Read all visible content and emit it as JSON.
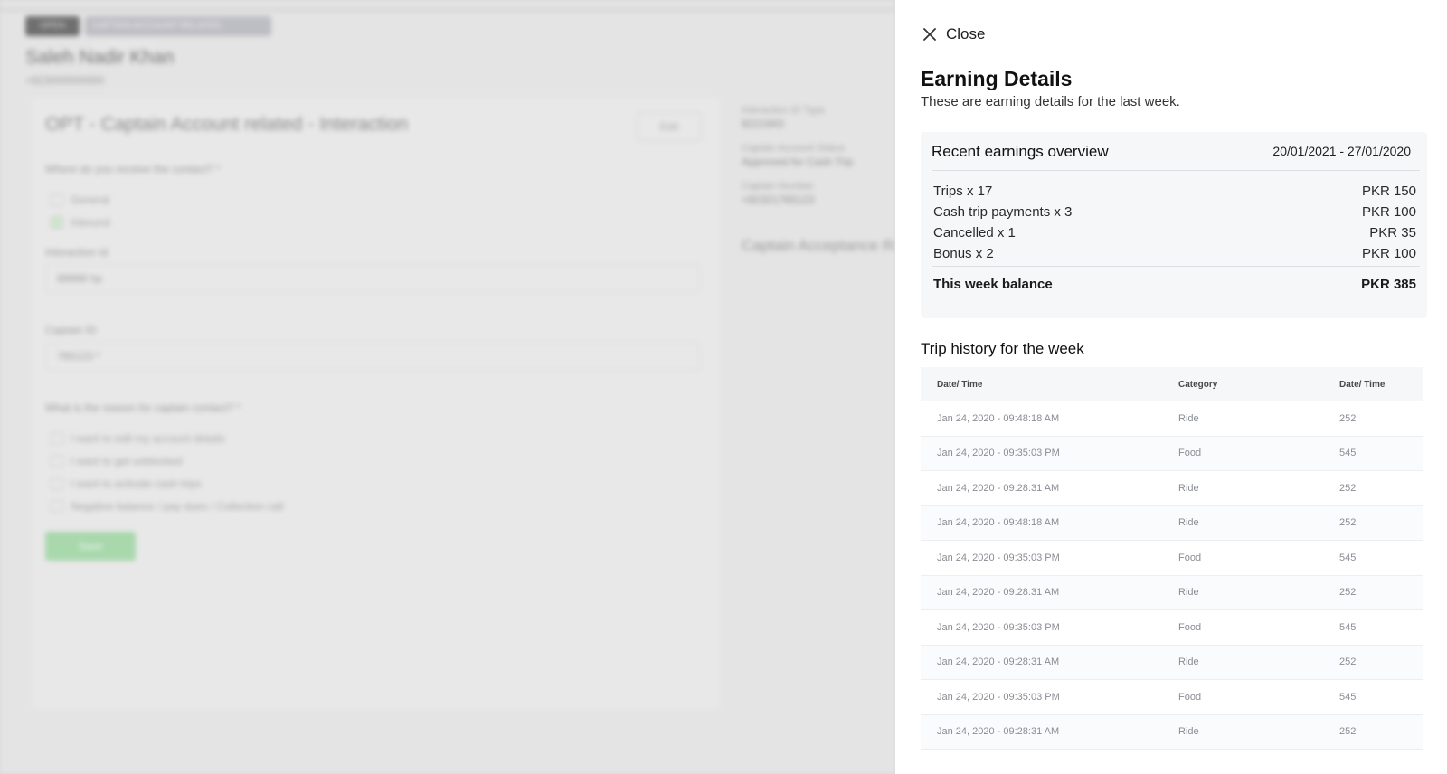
{
  "background": {
    "badge_dark": "OPEN",
    "badge_light": "CAPTAIN ACCOUNT RELATED · INTERACTION",
    "person_name": "Saleh Nadir Khan",
    "person_sub": "+923000000000",
    "card_title": "OPT - Captain Account related - Interaction",
    "card_button": "Edit",
    "question1": "Where do you receive the contact? *",
    "option_general": "General",
    "option_inbound": "Inbound",
    "interaction_label": "Interaction Id",
    "interaction_value": "88888 hp",
    "captain_label": "Captain ID",
    "captain_value": "765123 *",
    "question2": "What is the reason for captain contact? *",
    "reasons": [
      "I want to edit my account details",
      "I want to get unblocked",
      "I want to activate cash trips",
      "Negative balance / pay dues / Collection call"
    ],
    "save_button": "Save",
    "right_label1": "Interaction ID Type",
    "right_value1": "8221943",
    "right_label2": "Captain Account Status",
    "right_value2": "Approved for Cash Trip",
    "right_label3": "Captain Number",
    "right_value3": "+92321765123",
    "right_title": "Captain Acceptance Rate"
  },
  "drawer": {
    "close_label": "Close",
    "title": "Earning Details",
    "subtitle": "These are earning details for the last week.",
    "overview": {
      "heading": "Recent earnings overview",
      "date_range": "20/01/2021 - 27/01/2020",
      "items": [
        {
          "label": "Trips x 17",
          "amount": "PKR 150"
        },
        {
          "label": "Cash trip payments x 3",
          "amount": "PKR 100"
        },
        {
          "label": "Cancelled x 1",
          "amount": "PKR 35"
        },
        {
          "label": "Bonus x 2",
          "amount": "PKR 100"
        }
      ],
      "total_label": "This week balance",
      "total_amount": "PKR 385"
    },
    "history": {
      "title": "Trip history for the week",
      "columns": [
        "Date/ Time",
        "Category",
        "Date/ Time"
      ],
      "rows": [
        [
          "Jan 24, 2020 - 09:48:18 AM",
          "Ride",
          "252"
        ],
        [
          "Jan 24, 2020 - 09:35:03 PM",
          "Food",
          "545"
        ],
        [
          "Jan 24, 2020 - 09:28:31 AM",
          "Ride",
          "252"
        ],
        [
          "Jan 24, 2020 - 09:48:18 AM",
          "Ride",
          "252"
        ],
        [
          "Jan 24, 2020 - 09:35:03 PM",
          "Food",
          "545"
        ],
        [
          "Jan 24, 2020 - 09:28:31 AM",
          "Ride",
          "252"
        ],
        [
          "Jan 24, 2020 - 09:35:03 PM",
          "Food",
          "545"
        ],
        [
          "Jan 24, 2020 - 09:28:31 AM",
          "Ride",
          "252"
        ],
        [
          "Jan 24, 2020 - 09:35:03 PM",
          "Food",
          "545"
        ],
        [
          "Jan 24, 2020 - 09:28:31 AM",
          "Ride",
          "252"
        ]
      ]
    }
  },
  "colors": {
    "overlay": "#d8d8d8",
    "panel_bg": "#ffffff",
    "card_bg": "#f6f7f9",
    "muted_text": "#8a8d94",
    "green_button": "#a8d8ac"
  }
}
